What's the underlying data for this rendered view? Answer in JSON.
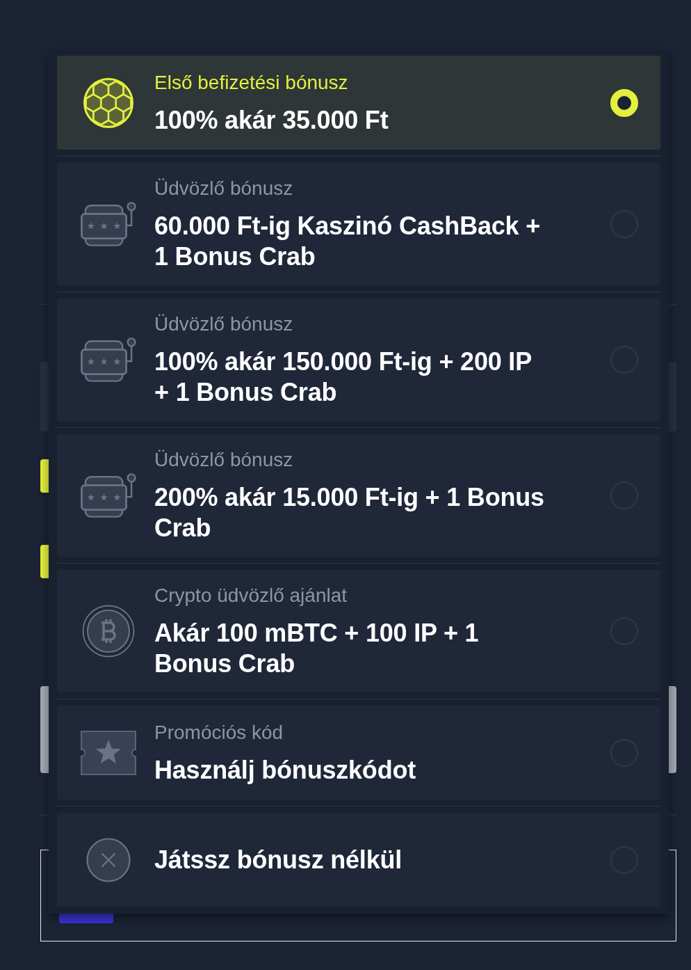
{
  "bonus_options": [
    {
      "kind": "sports",
      "category": "Első befizetési bónusz",
      "title": "100% akár 35.000 Ft",
      "selected": true
    },
    {
      "kind": "casino",
      "category": "Üdvözlő bónusz",
      "title": "60.000 Ft-ig Kaszinó CashBack + 1 Bonus Crab",
      "selected": false
    },
    {
      "kind": "casino",
      "category": "Üdvözlő bónusz",
      "title": "100% akár 150.000 Ft-ig + 200 IP + 1 Bonus Crab",
      "selected": false
    },
    {
      "kind": "casino",
      "category": "Üdvözlő bónusz",
      "title": "200% akár 15.000 Ft-ig + 1 Bonus Crab",
      "selected": false
    },
    {
      "kind": "crypto",
      "category": "Crypto üdvözlő ajánlat",
      "title": "Akár 100 mBTC + 100 IP + 1 Bonus Crab",
      "selected": false
    },
    {
      "kind": "promo_code",
      "category": "Promóciós kód",
      "title": "Használj bónuszkódot",
      "selected": false
    },
    {
      "kind": "no_bonus",
      "title": "Játssz bónusz nélkül",
      "selected": false
    }
  ]
}
